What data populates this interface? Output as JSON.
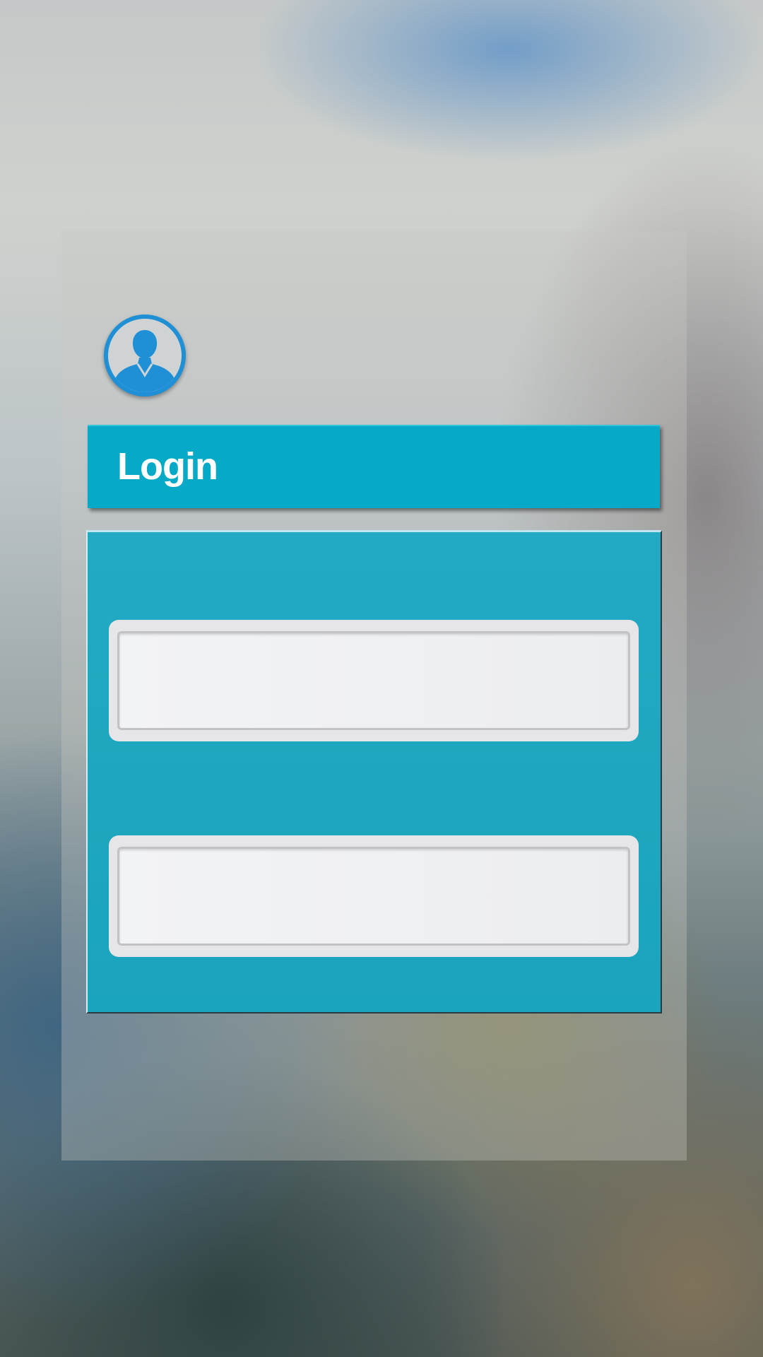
{
  "header": {
    "title": "Login"
  },
  "avatar": {
    "icon": "user-silhouette-icon",
    "ring_color": "#1f8fd6"
  },
  "form": {
    "username": {
      "label": "",
      "value": "",
      "placeholder": ""
    },
    "password": {
      "label": "",
      "value": "",
      "placeholder": ""
    }
  },
  "colors": {
    "header_bg": "#06a9c6",
    "card_bg": "#1ea6c0",
    "field_bg": "#eeeff1"
  }
}
